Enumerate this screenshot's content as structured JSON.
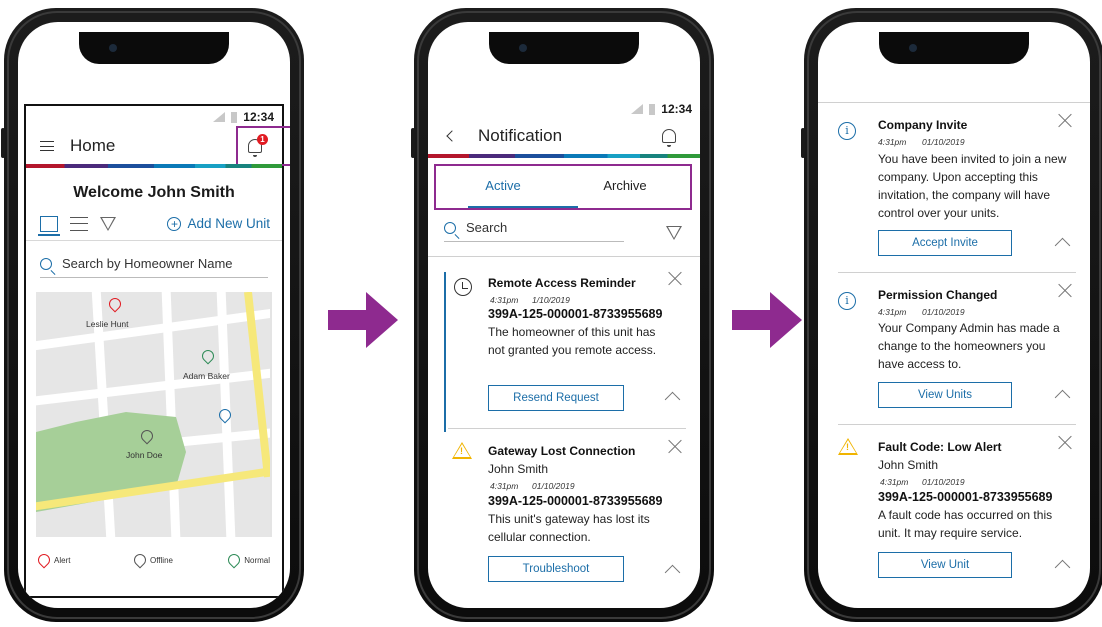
{
  "colors": {
    "accent": "#1c6ea8",
    "highlight": "#8e2a8f",
    "arrow": "#8e2a8f",
    "alert": "#e11b22",
    "offline": "#555555",
    "normal": "#2e8b57",
    "warning": "#f0b400"
  },
  "screen1": {
    "status_time": "12:34",
    "title": "Home",
    "badge_count": "1",
    "welcome": "Welcome John Smith",
    "add_unit": "Add New Unit",
    "search_placeholder": "Search by Homeowner Name",
    "map_markers": [
      {
        "label": "Leslie Hunt",
        "status": "alert"
      },
      {
        "label": "Adam Baker",
        "status": "normal"
      },
      {
        "label": "John Doe",
        "status": "offline"
      }
    ],
    "legend": {
      "alert": "Alert",
      "offline": "Offline",
      "normal": "Normal"
    }
  },
  "screen2": {
    "status_time": "12:34",
    "title": "Notification",
    "tabs": {
      "active": "Active",
      "archive": "Archive"
    },
    "search_label": "Search",
    "cards": [
      {
        "title": "Remote Access Reminder",
        "time": "4:31pm",
        "date": "1/10/2019",
        "serial": "399A-125-000001-8733955689",
        "body": "The homeowner of this unit has not granted you remote access.",
        "button": "Resend Request"
      },
      {
        "title": "Gateway Lost Connection",
        "subtitle": "John Smith",
        "time": "4:31pm",
        "date": "01/10/2019",
        "serial": "399A-125-000001-8733955689",
        "body": "This unit's gateway has lost its cellular connection.",
        "button": "Troubleshoot"
      }
    ]
  },
  "screen3": {
    "cards": [
      {
        "title": "Company Invite",
        "time": "4:31pm",
        "date": "01/10/2019",
        "body": "You have been invited to join a new company. Upon accepting this invitation, the company will have control over your units.",
        "button": "Accept Invite"
      },
      {
        "title": "Permission Changed",
        "time": "4:31pm",
        "date": "01/10/2019",
        "body": "Your Company Admin has made a change to the homeowners you have access to.",
        "button": "View Units"
      },
      {
        "title": "Fault Code: Low Alert",
        "subtitle": "John Smith",
        "time": "4:31pm",
        "date": "01/10/2019",
        "serial": "399A-125-000001-8733955689",
        "body": "A fault code has occurred on this unit. It may require service.",
        "button": "View Unit"
      }
    ]
  }
}
